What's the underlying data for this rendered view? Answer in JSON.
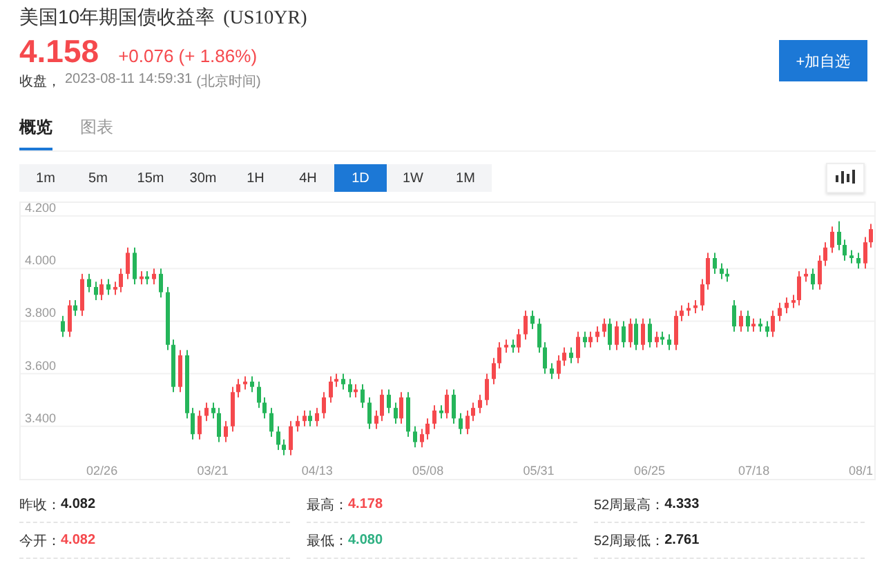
{
  "header": {
    "title": "美国10年期国债收益率",
    "symbol": "(US10YR)",
    "price": "4.158",
    "change": "+0.076 (+ 1.86%)",
    "status": "收盘，",
    "time": "2023-08-11 14:59:31",
    "timezone": "(北京时间)",
    "add_button": "+加自选"
  },
  "tabs": [
    {
      "label": "概览",
      "selected": true
    },
    {
      "label": "图表",
      "selected": false
    }
  ],
  "intervals": [
    {
      "label": "1m",
      "selected": false
    },
    {
      "label": "5m",
      "selected": false
    },
    {
      "label": "15m",
      "selected": false
    },
    {
      "label": "30m",
      "selected": false
    },
    {
      "label": "1H",
      "selected": false
    },
    {
      "label": "4H",
      "selected": false
    },
    {
      "label": "1D",
      "selected": true
    },
    {
      "label": "1W",
      "selected": false
    },
    {
      "label": "1M",
      "selected": false
    }
  ],
  "chart": {
    "chart_data": {
      "type": "candlestick",
      "categories": [
        null,
        null,
        null,
        null,
        null,
        null,
        "02/26",
        null,
        null,
        null,
        null,
        null,
        null,
        null,
        null,
        null,
        null,
        null,
        null,
        null,
        null,
        null,
        null,
        "03/21",
        null,
        null,
        null,
        null,
        null,
        null,
        null,
        null,
        null,
        null,
        null,
        null,
        null,
        null,
        null,
        "04/13",
        null,
        null,
        null,
        null,
        null,
        null,
        null,
        null,
        null,
        null,
        null,
        null,
        null,
        null,
        null,
        null,
        "05/08",
        null,
        null,
        null,
        null,
        null,
        null,
        null,
        null,
        null,
        null,
        null,
        null,
        null,
        null,
        null,
        null,
        "05/31",
        null,
        null,
        null,
        null,
        null,
        null,
        null,
        null,
        null,
        null,
        null,
        null,
        null,
        null,
        null,
        null,
        "06/25",
        null,
        null,
        null,
        null,
        null,
        null,
        null,
        null,
        null,
        null,
        null,
        null,
        null,
        null,
        null,
        "07/18",
        null,
        null,
        null,
        null,
        null,
        null,
        null,
        null,
        null,
        null,
        null,
        null,
        null,
        null,
        null,
        null,
        "08/1",
        null
      ],
      "ylim": [
        3.2,
        4.25
      ],
      "grid": true,
      "ohlc": [
        [
          3.8,
          3.82,
          3.74,
          3.76
        ],
        [
          3.76,
          3.88,
          3.74,
          3.86
        ],
        [
          3.86,
          3.88,
          3.82,
          3.84
        ],
        [
          3.84,
          3.98,
          3.82,
          3.96
        ],
        [
          3.96,
          3.98,
          3.91,
          3.93
        ],
        [
          3.93,
          3.95,
          3.88,
          3.9
        ],
        [
          3.9,
          3.96,
          3.88,
          3.94
        ],
        [
          3.94,
          3.96,
          3.9,
          3.92
        ],
        [
          3.92,
          3.95,
          3.9,
          3.93
        ],
        [
          3.93,
          4.0,
          3.91,
          3.98
        ],
        [
          3.98,
          4.08,
          3.96,
          4.06
        ],
        [
          4.06,
          4.08,
          3.94,
          3.96
        ],
        [
          3.96,
          3.99,
          3.94,
          3.97
        ],
        [
          3.97,
          3.99,
          3.94,
          3.96
        ],
        [
          3.96,
          4.0,
          3.94,
          3.98
        ],
        [
          3.98,
          4.0,
          3.89,
          3.91
        ],
        [
          3.91,
          3.93,
          3.69,
          3.71
        ],
        [
          3.71,
          3.73,
          3.53,
          3.55
        ],
        [
          3.55,
          3.69,
          3.53,
          3.67
        ],
        [
          3.67,
          3.69,
          3.43,
          3.45
        ],
        [
          3.45,
          3.47,
          3.35,
          3.37
        ],
        [
          3.37,
          3.46,
          3.35,
          3.44
        ],
        [
          3.44,
          3.49,
          3.42,
          3.47
        ],
        [
          3.47,
          3.49,
          3.43,
          3.45
        ],
        [
          3.45,
          3.47,
          3.34,
          3.36
        ],
        [
          3.36,
          3.42,
          3.34,
          3.4
        ],
        [
          3.4,
          3.55,
          3.38,
          3.53
        ],
        [
          3.53,
          3.58,
          3.51,
          3.56
        ],
        [
          3.56,
          3.59,
          3.54,
          3.57
        ],
        [
          3.57,
          3.59,
          3.53,
          3.55
        ],
        [
          3.55,
          3.57,
          3.47,
          3.49
        ],
        [
          3.49,
          3.51,
          3.43,
          3.45
        ],
        [
          3.45,
          3.47,
          3.36,
          3.38
        ],
        [
          3.38,
          3.4,
          3.31,
          3.33
        ],
        [
          3.33,
          3.35,
          3.29,
          3.31
        ],
        [
          3.31,
          3.42,
          3.29,
          3.4
        ],
        [
          3.4,
          3.44,
          3.38,
          3.42
        ],
        [
          3.42,
          3.46,
          3.4,
          3.44
        ],
        [
          3.44,
          3.46,
          3.4,
          3.42
        ],
        [
          3.42,
          3.47,
          3.4,
          3.45
        ],
        [
          3.45,
          3.53,
          3.43,
          3.51
        ],
        [
          3.51,
          3.59,
          3.49,
          3.57
        ],
        [
          3.57,
          3.6,
          3.55,
          3.58
        ],
        [
          3.58,
          3.6,
          3.54,
          3.56
        ],
        [
          3.56,
          3.58,
          3.51,
          3.53
        ],
        [
          3.53,
          3.56,
          3.51,
          3.54
        ],
        [
          3.54,
          3.56,
          3.47,
          3.49
        ],
        [
          3.49,
          3.51,
          3.39,
          3.41
        ],
        [
          3.41,
          3.46,
          3.39,
          3.44
        ],
        [
          3.44,
          3.54,
          3.42,
          3.52
        ],
        [
          3.52,
          3.54,
          3.45,
          3.47
        ],
        [
          3.47,
          3.49,
          3.41,
          3.43
        ],
        [
          3.43,
          3.53,
          3.41,
          3.51
        ],
        [
          3.51,
          3.53,
          3.36,
          3.38
        ],
        [
          3.38,
          3.4,
          3.32,
          3.34
        ],
        [
          3.34,
          3.39,
          3.32,
          3.37
        ],
        [
          3.37,
          3.43,
          3.35,
          3.41
        ],
        [
          3.41,
          3.48,
          3.39,
          3.46
        ],
        [
          3.46,
          3.48,
          3.43,
          3.45
        ],
        [
          3.45,
          3.54,
          3.43,
          3.52
        ],
        [
          3.52,
          3.54,
          3.41,
          3.43
        ],
        [
          3.43,
          3.45,
          3.37,
          3.39
        ],
        [
          3.39,
          3.46,
          3.37,
          3.44
        ],
        [
          3.44,
          3.49,
          3.42,
          3.47
        ],
        [
          3.47,
          3.52,
          3.45,
          3.5
        ],
        [
          3.5,
          3.6,
          3.48,
          3.58
        ],
        [
          3.58,
          3.66,
          3.56,
          3.64
        ],
        [
          3.64,
          3.72,
          3.62,
          3.7
        ],
        [
          3.7,
          3.73,
          3.68,
          3.71
        ],
        [
          3.71,
          3.73,
          3.68,
          3.7
        ],
        [
          3.7,
          3.77,
          3.68,
          3.75
        ],
        [
          3.75,
          3.84,
          3.73,
          3.82
        ],
        [
          3.82,
          3.84,
          3.77,
          3.79
        ],
        [
          3.79,
          3.81,
          3.68,
          3.7
        ],
        [
          3.7,
          3.72,
          3.6,
          3.62
        ],
        [
          3.62,
          3.64,
          3.58,
          3.6
        ],
        [
          3.6,
          3.67,
          3.58,
          3.65
        ],
        [
          3.65,
          3.7,
          3.63,
          3.68
        ],
        [
          3.68,
          3.7,
          3.64,
          3.66
        ],
        [
          3.66,
          3.76,
          3.64,
          3.74
        ],
        [
          3.74,
          3.76,
          3.7,
          3.72
        ],
        [
          3.72,
          3.76,
          3.7,
          3.74
        ],
        [
          3.74,
          3.78,
          3.72,
          3.76
        ],
        [
          3.76,
          3.81,
          3.74,
          3.79
        ],
        [
          3.79,
          3.81,
          3.69,
          3.71
        ],
        [
          3.71,
          3.8,
          3.69,
          3.78
        ],
        [
          3.78,
          3.8,
          3.7,
          3.72
        ],
        [
          3.72,
          3.81,
          3.7,
          3.79
        ],
        [
          3.79,
          3.81,
          3.69,
          3.71
        ],
        [
          3.71,
          3.81,
          3.69,
          3.79
        ],
        [
          3.79,
          3.81,
          3.7,
          3.72
        ],
        [
          3.72,
          3.76,
          3.7,
          3.74
        ],
        [
          3.74,
          3.76,
          3.71,
          3.73
        ],
        [
          3.73,
          3.75,
          3.69,
          3.71
        ],
        [
          3.71,
          3.84,
          3.69,
          3.82
        ],
        [
          3.82,
          3.86,
          3.8,
          3.84
        ],
        [
          3.84,
          3.87,
          3.82,
          3.85
        ],
        [
          3.85,
          3.88,
          3.83,
          3.86
        ],
        [
          3.86,
          3.96,
          3.84,
          3.94
        ],
        [
          3.94,
          4.06,
          3.92,
          4.04
        ],
        [
          4.04,
          4.06,
          3.98,
          4.0
        ],
        [
          4.0,
          4.02,
          3.96,
          3.98
        ],
        [
          3.98,
          4.0,
          3.95,
          3.97
        ],
        [
          3.86,
          3.88,
          3.76,
          3.78
        ],
        [
          3.78,
          3.84,
          3.76,
          3.82
        ],
        [
          3.82,
          3.84,
          3.76,
          3.78
        ],
        [
          3.78,
          3.81,
          3.76,
          3.79
        ],
        [
          3.79,
          3.81,
          3.76,
          3.78
        ],
        [
          3.78,
          3.8,
          3.74,
          3.76
        ],
        [
          3.76,
          3.84,
          3.74,
          3.82
        ],
        [
          3.82,
          3.87,
          3.8,
          3.85
        ],
        [
          3.85,
          3.89,
          3.83,
          3.87
        ],
        [
          3.87,
          3.9,
          3.85,
          3.88
        ],
        [
          3.88,
          3.99,
          3.86,
          3.97
        ],
        [
          3.97,
          4.0,
          3.95,
          3.98
        ],
        [
          3.98,
          4.0,
          3.92,
          3.94
        ],
        [
          3.94,
          4.05,
          3.92,
          4.03
        ],
        [
          4.03,
          4.1,
          4.01,
          4.08
        ],
        [
          4.08,
          4.16,
          4.06,
          4.14
        ],
        [
          4.14,
          4.18,
          4.07,
          4.09
        ],
        [
          4.09,
          4.11,
          4.03,
          4.05
        ],
        [
          4.05,
          4.07,
          4.02,
          4.04
        ],
        [
          4.04,
          4.06,
          4.0,
          4.02
        ],
        [
          4.02,
          4.12,
          4.0,
          4.1
        ],
        [
          4.1,
          4.17,
          4.08,
          4.15
        ]
      ],
      "yticks": [
        {
          "value": 4.2,
          "label": "4.200"
        },
        {
          "value": 4.0,
          "label": "4.000"
        },
        {
          "value": 3.8,
          "label": "3.800"
        },
        {
          "value": 3.6,
          "label": "3.600"
        },
        {
          "value": 3.4,
          "label": "3.400"
        }
      ]
    }
  },
  "stats": [
    {
      "label": "昨收：",
      "value": "4.082",
      "color": "#222222"
    },
    {
      "label": "最高：",
      "value": "4.178",
      "color": "#f5494d"
    },
    {
      "label": "52周最高：",
      "value": "4.333",
      "color": "#222222"
    },
    {
      "label": "今开：",
      "value": "4.082",
      "color": "#f5494d"
    },
    {
      "label": "最低：",
      "value": "4.080",
      "color": "#2eb082"
    },
    {
      "label": "52周最低：",
      "value": "2.761",
      "color": "#222222"
    }
  ]
}
